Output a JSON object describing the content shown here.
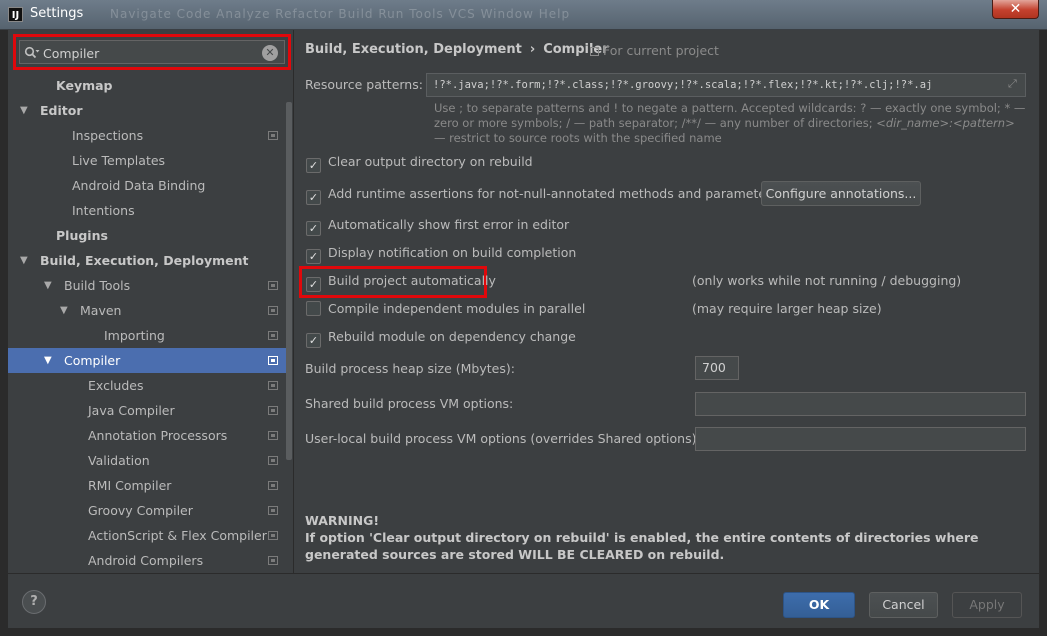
{
  "window": {
    "title": "Settings",
    "logo_text": "IJ",
    "close_glyph": "✕",
    "menu_ghost": "Navigate  Code  Analyze  Refactor  Build  Run  Tools  VCS  Window  Help"
  },
  "search": {
    "value": "Compiler",
    "placeholder": ""
  },
  "tree": [
    {
      "label": "Keymap",
      "level": 1,
      "bold": true
    },
    {
      "label": "Editor",
      "level": 0,
      "bold": true,
      "arrow": "▼"
    },
    {
      "label": "Inspections",
      "level": 2,
      "icon": true
    },
    {
      "label": "Live Templates",
      "level": 2
    },
    {
      "label": "Android Data Binding",
      "level": 2
    },
    {
      "label": "Intentions",
      "level": 2
    },
    {
      "label": "Plugins",
      "level": 1,
      "bold": true
    },
    {
      "label": "Build, Execution, Deployment",
      "level": 0,
      "bold": true,
      "arrow": "▼"
    },
    {
      "label": "Build Tools",
      "level": 1.5,
      "arrow": "▼",
      "icon": true
    },
    {
      "label": "Maven",
      "level": 2.5,
      "arrow": "▼",
      "icon": true
    },
    {
      "label": "Importing",
      "level": 4,
      "icon": true
    },
    {
      "label": "Compiler",
      "level": 1.5,
      "arrow": "▼",
      "icon": true,
      "selected": true
    },
    {
      "label": "Excludes",
      "level": 3,
      "icon": true
    },
    {
      "label": "Java Compiler",
      "level": 3,
      "icon": true
    },
    {
      "label": "Annotation Processors",
      "level": 3,
      "icon": true
    },
    {
      "label": "Validation",
      "level": 3,
      "icon": true
    },
    {
      "label": "RMI Compiler",
      "level": 3,
      "icon": true
    },
    {
      "label": "Groovy Compiler",
      "level": 3,
      "icon": true
    },
    {
      "label": "ActionScript & Flex Compiler",
      "level": 3,
      "icon": true
    },
    {
      "label": "Android Compilers",
      "level": 3,
      "icon": true
    }
  ],
  "breadcrumb": {
    "part1": "Build, Execution, Deployment",
    "separator": "›",
    "part2": "Compiler",
    "scope": "For current project"
  },
  "resource_patterns": {
    "label": "Resource patterns:",
    "value": "!?*.java;!?*.form;!?*.class;!?*.groovy;!?*.scala;!?*.flex;!?*.kt;!?*.clj;!?*.aj",
    "hint_1": "Use ; to separate patterns and ! to negate a pattern. Accepted wildcards: ? — exactly one symbol; * — zero or more symbols; / — path separator; /**/ — any number of directories; ",
    "hint_2": "<dir_name>:<pattern>",
    "hint_3": " — restrict to source roots with the specified name"
  },
  "options": {
    "clear_output": {
      "label": "Clear output directory on rebuild",
      "checked": true
    },
    "runtime_assertions": {
      "label": "Add runtime assertions for not-null-annotated methods and parameters",
      "checked": true
    },
    "configure_annotations": "Configure annotations...",
    "show_first_error": {
      "label": "Automatically show first error in editor",
      "checked": true
    },
    "display_notification": {
      "label": "Display notification on build completion",
      "checked": true
    },
    "build_automatically": {
      "label": "Build project automatically",
      "checked": true,
      "note": "(only works while not running / debugging)"
    },
    "compile_parallel": {
      "label": "Compile independent modules in parallel",
      "checked": false,
      "note": "(may require larger heap size)"
    },
    "rebuild_module": {
      "label": "Rebuild module on dependency change",
      "checked": true
    }
  },
  "heap_size": {
    "label": "Build process heap size (Mbytes):",
    "value": "700"
  },
  "shared_vm": {
    "label": "Shared build process VM options:",
    "value": ""
  },
  "user_vm": {
    "label": "User-local build process VM options (overrides Shared options):",
    "value": ""
  },
  "warning": {
    "title": "WARNING!",
    "text": "If option 'Clear output directory on rebuild' is enabled, the entire contents of directories where generated sources are stored WILL BE CLEARED on rebuild."
  },
  "buttons": {
    "help": "?",
    "ok": "OK",
    "cancel": "Cancel",
    "apply": "Apply"
  },
  "check_glyph": "✓",
  "colors": {
    "accent": "#4b6eaf",
    "highlight": "#e0080b",
    "background": "#3c3f41"
  }
}
